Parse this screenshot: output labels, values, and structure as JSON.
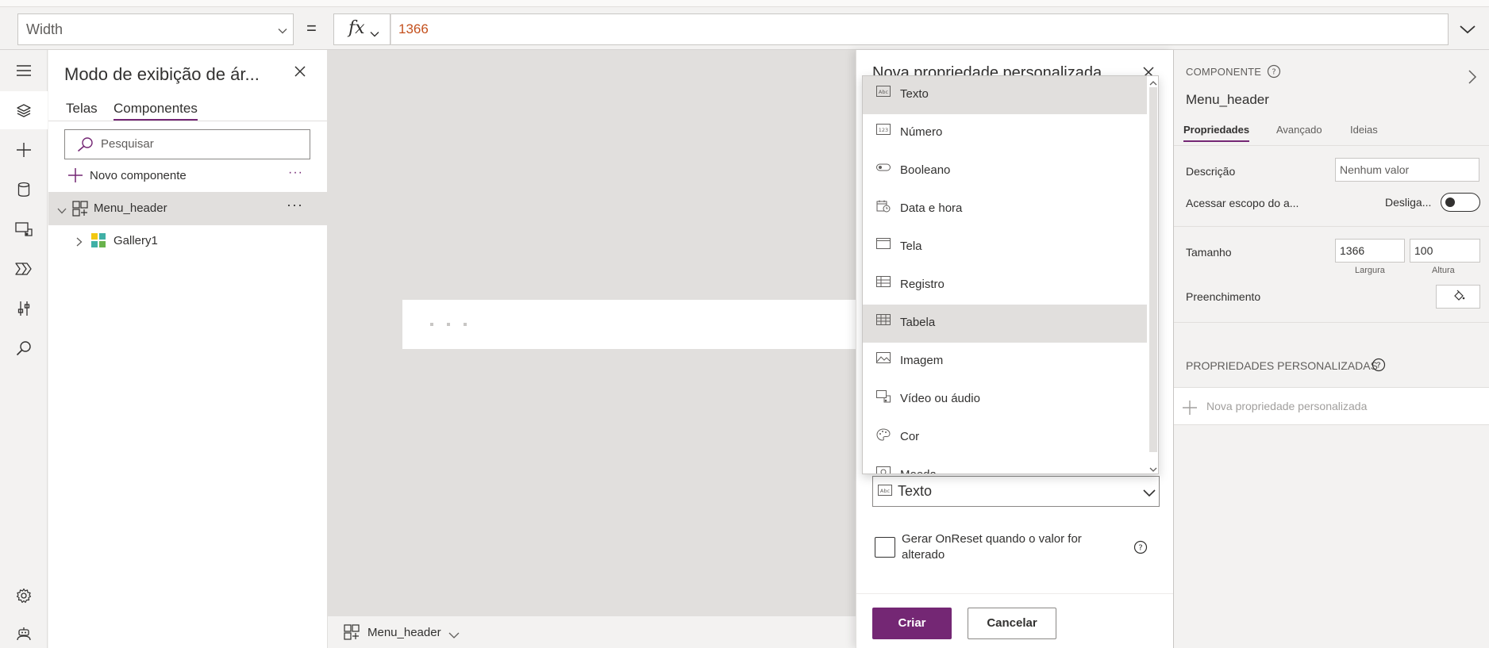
{
  "formula_bar": {
    "property": "Width",
    "equals": "=",
    "fx_label": "fx",
    "formula": "1366"
  },
  "tree": {
    "title": "Modo de exibição de ár...",
    "tabs": [
      "Telas",
      "Componentes"
    ],
    "search_placeholder": "Pesquisar",
    "new_component": "Novo componente",
    "more": "···",
    "items": [
      {
        "label": "Menu_header",
        "expanded": true
      },
      {
        "label": "Gallery1",
        "expanded": false
      }
    ]
  },
  "canvas": {
    "component_label": "Menu_header"
  },
  "dialog": {
    "title": "Nova propriedade personalizada",
    "type_options": [
      {
        "label": "Texto",
        "icon": "text-type-icon"
      },
      {
        "label": "Número",
        "icon": "number-type-icon"
      },
      {
        "label": "Booleano",
        "icon": "toggle-type-icon"
      },
      {
        "label": "Data e hora",
        "icon": "datetime-type-icon"
      },
      {
        "label": "Tela",
        "icon": "screen-type-icon"
      },
      {
        "label": "Registro",
        "icon": "record-type-icon"
      },
      {
        "label": "Tabela",
        "icon": "table-type-icon"
      },
      {
        "label": "Imagem",
        "icon": "image-type-icon"
      },
      {
        "label": "Vídeo ou áudio",
        "icon": "media-type-icon"
      },
      {
        "label": "Cor",
        "icon": "color-palette-icon"
      },
      {
        "label": "Moeda",
        "icon": "currency-type-icon"
      }
    ],
    "selected_option": "Texto",
    "highlighted_option": "Tabela",
    "selected_type": "Texto",
    "onreset_label": "Gerar OnReset quando o valor for alterado",
    "create_button": "Criar",
    "cancel_button": "Cancelar"
  },
  "properties": {
    "section": "COMPONENTE",
    "component_name": "Menu_header",
    "tabs": [
      "Propriedades",
      "Avançado",
      "Ideias"
    ],
    "description_label": "Descrição",
    "description_placeholder": "Nenhum valor",
    "scope_label": "Acessar escopo do a...",
    "scope_value": "Desliga...",
    "size_label": "Tamanho",
    "width": "1366",
    "height": "100",
    "width_label": "Largura",
    "height_label": "Altura",
    "fill_label": "Preenchimento",
    "custom_section": "PROPRIEDADES PERSONALIZADAS",
    "new_custom": "Nova propriedade personalizada"
  },
  "colors": {
    "accent": "#742774",
    "formula_text": "#c4501d"
  }
}
